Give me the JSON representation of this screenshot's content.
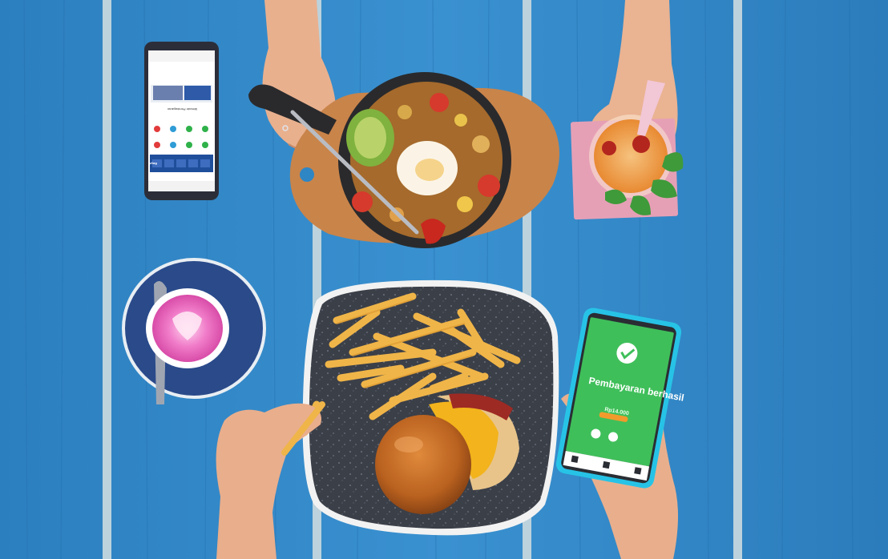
{
  "scene": {
    "description_colors": {
      "table_blue": "#2f86c4",
      "table_blue_dark": "#1f6aa6",
      "plank_gap": "#b8cfd9",
      "skillet": "#2a2a2c",
      "board_wood": "#c9844a",
      "plate_gray": "#3b3f48",
      "saucer_navy": "#2a4a8a",
      "latte_pink": "#e862b8",
      "phone_green": "#3fbf5a",
      "phone_case_cyan": "#27c3e6",
      "fries_yellow": "#f1b84a",
      "bun_brown": "#c9722b",
      "drink_orange": "#f0a14d",
      "mint_green": "#3f9a3a"
    }
  },
  "phone_right": {
    "screen_title": "Pembayaran berhasil",
    "amount": "Rp14.000"
  },
  "phone_left": {
    "header": "Bayar",
    "section_title": "Metode Pembayaran"
  }
}
